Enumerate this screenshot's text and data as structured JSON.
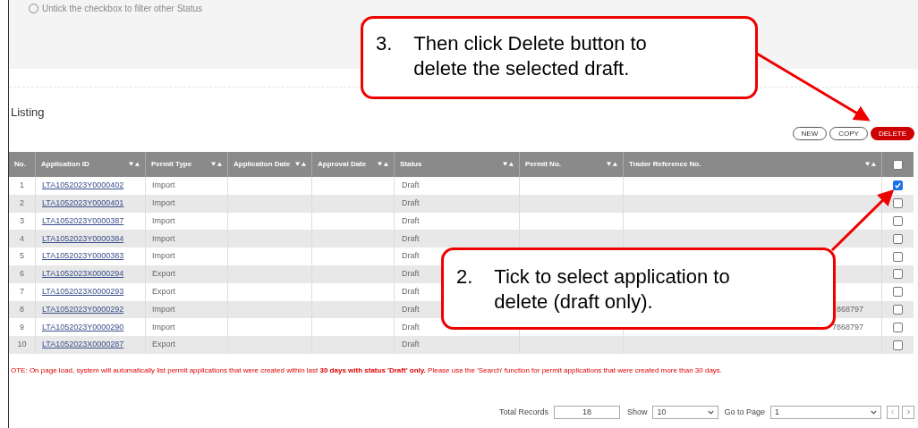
{
  "filter_hint": "Untick the checkbox to filter other Status",
  "section_title": "Listing",
  "buttons": [
    {
      "label": "NEW",
      "kind": "plain"
    },
    {
      "label": "COPY",
      "kind": "plain"
    },
    {
      "label": "DELETE",
      "kind": "danger"
    }
  ],
  "table": {
    "columns": [
      {
        "label": "No.",
        "sortable": false
      },
      {
        "label": "Application ID",
        "sortable": true
      },
      {
        "label": "Permit Type",
        "sortable": true
      },
      {
        "label": "Application Date",
        "sortable": true
      },
      {
        "label": "Approval Date",
        "sortable": true
      },
      {
        "label": "Status",
        "sortable": true
      },
      {
        "label": "Permit No.",
        "sortable": true
      },
      {
        "label": "Trader Reference No.",
        "sortable": true
      }
    ],
    "select_all_checked": false,
    "rows": [
      {
        "no": "1",
        "id": "LTA1052023Y0000402",
        "type": "Import",
        "status": "Draft",
        "trader_ref": "",
        "checked": true
      },
      {
        "no": "2",
        "id": "LTA1052023Y0000401",
        "type": "Import",
        "status": "Draft",
        "trader_ref": "",
        "checked": false
      },
      {
        "no": "3",
        "id": "LTA1052023Y0000387",
        "type": "Import",
        "status": "Draft",
        "trader_ref": "",
        "checked": false
      },
      {
        "no": "4",
        "id": "LTA1052023Y0000384",
        "type": "Import",
        "status": "Draft",
        "trader_ref": "",
        "checked": false
      },
      {
        "no": "5",
        "id": "LTA1052023Y0000383",
        "type": "Import",
        "status": "Draft",
        "trader_ref": "",
        "checked": false
      },
      {
        "no": "6",
        "id": "LTA1052023X0000294",
        "type": "Export",
        "status": "Draft",
        "trader_ref": "",
        "checked": false
      },
      {
        "no": "7",
        "id": "LTA1052023X0000293",
        "type": "Export",
        "status": "Draft",
        "trader_ref": "",
        "checked": false
      },
      {
        "no": "8",
        "id": "LTA1052023Y0000292",
        "type": "Import",
        "status": "Draft",
        "trader_ref": "868797",
        "checked": false
      },
      {
        "no": "9",
        "id": "LTA1052023Y0000290",
        "type": "Import",
        "status": "Draft",
        "trader_ref": "7868797",
        "checked": false
      },
      {
        "no": "10",
        "id": "LTA1052023X0000287",
        "type": "Export",
        "status": "Draft",
        "trader_ref": "",
        "checked": false
      }
    ]
  },
  "note": "OTE: On page load, system will automatically list permit applications that were created within last **30 days with status 'Draft' only.** Please use the 'Search' function for permit applications that were created more than 30 days.",
  "pagination": {
    "total_label": "Total Records",
    "total": "18",
    "show_label": "Show",
    "show_value": "10",
    "goto_label": "Go to Page",
    "page_value": "1"
  },
  "callouts": [
    {
      "number": "3.",
      "text": "Then click Delete button to delete the selected draft."
    },
    {
      "number": "2.",
      "text": "Tick to select application to delete (draft only)."
    }
  ]
}
